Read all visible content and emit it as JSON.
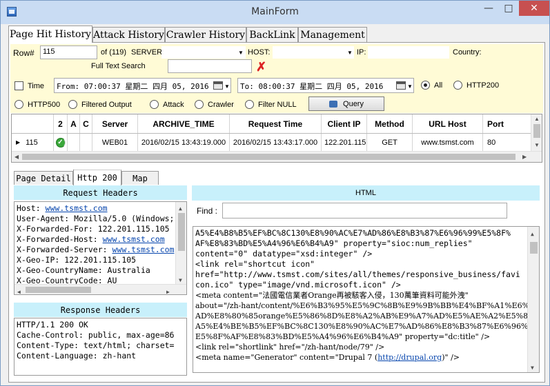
{
  "window": {
    "title": "MainForm"
  },
  "tabs": [
    "Page Hit History",
    "Attack History",
    "Crawler History",
    "BackLink",
    "Management"
  ],
  "filters": {
    "row_label": "Row#",
    "row_value": "115",
    "row_total": "of (119)",
    "server_label": "SERVER:",
    "server_value": "",
    "host_label": "HOST:",
    "host_value": "",
    "ip_label": "IP:",
    "ip_value": "",
    "country_label": "Country:",
    "fulltext_label": "Full Text Search",
    "fulltext_value": "",
    "time_label": "Time",
    "from_text": "From: 07:00:37 星期二   四月   05, 2016",
    "to_text": "To: 08:00:37 星期二   四月   05, 2016",
    "radio_all": "All",
    "radio_http200": "HTTP200",
    "radio_http500": "HTTP500",
    "radio_filtered": "Filtered Output",
    "radio_attack": "Attack",
    "radio_crawler": "Crawler",
    "radio_filter_null": "Filter NULL",
    "selected_radio": "All",
    "query_label": "Query"
  },
  "grid": {
    "columns": [
      "",
      "2",
      "A",
      "C",
      "Server",
      "ARCHIVE_TIME",
      "Request Time",
      "Client IP",
      "Method",
      "URL Host",
      "Port"
    ],
    "rows": [
      {
        "row_num": "115",
        "server": "WEB01",
        "archive_time": "2016/02/15 13:43:19.000",
        "request_time": "2016/02/15 13:43:17.000",
        "client_ip": "122.201.115....",
        "method": "GET",
        "url_host": "www.tsmst.com",
        "port": "80"
      }
    ]
  },
  "lower_tabs": [
    "Page Detail",
    "Http 200",
    "Map"
  ],
  "request_headers": {
    "title": "Request Headers",
    "lines": [
      [
        "Host: ",
        "www.tsmst.com"
      ],
      [
        "User-Agent: Mozilla/5.0 (Windows;",
        ""
      ],
      [
        "X-Forwarded-For: 122.201.115.105",
        ""
      ],
      [
        "X-Forwarded-Host: ",
        "www.tsmst.com"
      ],
      [
        "X-Forwarded-Server: ",
        "www.tsmst.com"
      ],
      [
        "X-Geo-IP: 122.201.115.105",
        ""
      ],
      [
        "X-Geo-CountryName: Australia",
        ""
      ],
      [
        "X-Geo-CountryCode: AU",
        ""
      ]
    ]
  },
  "response_headers": {
    "title": "Response Headers",
    "lines": [
      "HTTP/1.1 200 OK",
      "Cache-Control: public, max-age=86",
      "Content-Type: text/html; charset=",
      "Content-Language: zh-hant"
    ]
  },
  "html": {
    "title": "HTML",
    "find_label": "Find :",
    "find_value": "",
    "mono_lines": [
      "A5%E4%B8%B5%EF%BC%8C130%E8%90%AC%E7%AD%86%E8%B3%87%E6%96%99%E5%8F%",
      "AF%E8%83%BD%E5%A4%96%E6%B4%A9\" property=\"sioc:num_replies\"",
      "content=\"0\" datatype=\"xsd:integer\" />",
      "<link rel=\"shortcut icon\"",
      "href=\"http://www.tsmst.com/sites/all/themes/responsive_business/favi",
      "con.ico\" type=\"image/vnd.microsoft.icon\" />"
    ],
    "serif_lines": [
      "<meta content=\"法國電信業者Orange再被駭客入侵，130萬筆資料可能外洩\"",
      "about=\"/zh-hant/content/%E6%B3%95%E5%9C%8B%E9%9B%BB%E4%BF%A1%E6%A5%",
      "AD%E8%80%85orange%E5%86%8D%E8%A2%AB%E9%A7%AD%E5%AE%A2%E5%85%",
      "A5%E4%BE%B5%EF%BC%8C130%E8%90%AC%E7%AD%86%E8%B3%87%E6%96%99%",
      "E5%8F%AF%E8%83%BD%E5%A4%96%E6%B4%A9\" property=\"dc:title\" />",
      "<link rel=\"shortlink\" href=\"/zh-hant/node/79\" />"
    ],
    "generator_prefix": "<meta name=\"Generator\" content=\"Drupal 7 (",
    "generator_link": "http://drupal.org",
    "generator_suffix": ")\" />"
  }
}
